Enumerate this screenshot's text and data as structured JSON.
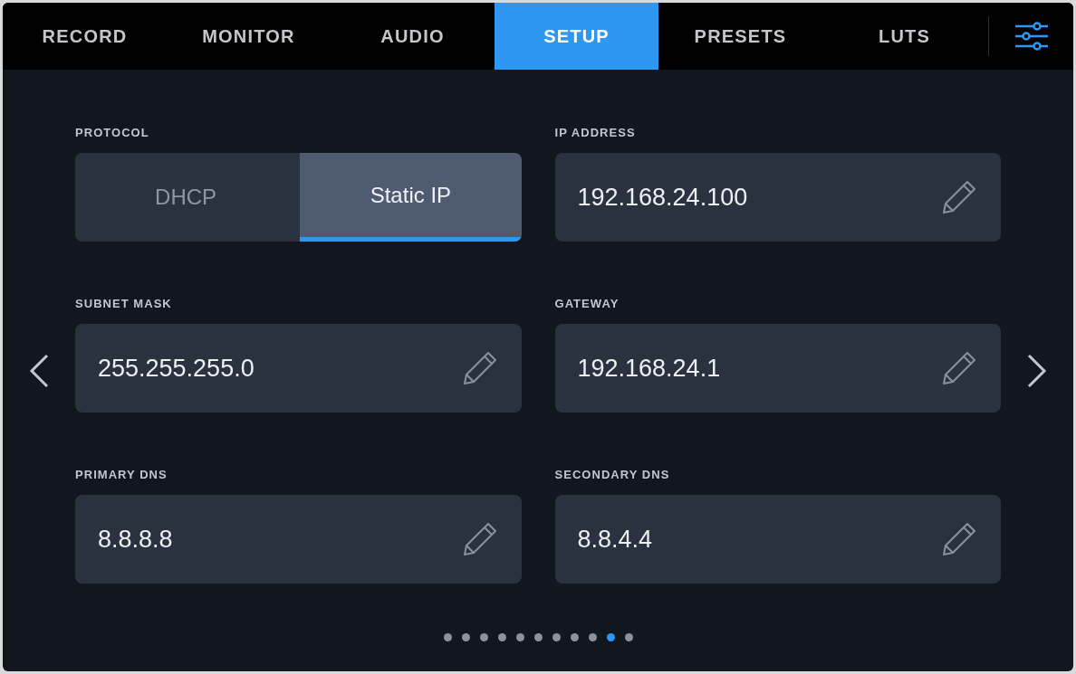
{
  "tabs": [
    {
      "label": "RECORD",
      "selected": false
    },
    {
      "label": "MONITOR",
      "selected": false
    },
    {
      "label": "AUDIO",
      "selected": false
    },
    {
      "label": "SETUP",
      "selected": true
    },
    {
      "label": "PRESETS",
      "selected": false
    },
    {
      "label": "LUTS",
      "selected": false
    }
  ],
  "fields": [
    {
      "kind": "toggle",
      "label": "PROTOCOL",
      "options": [
        {
          "label": "DHCP",
          "selected": false
        },
        {
          "label": "Static IP",
          "selected": true
        }
      ]
    },
    {
      "kind": "text",
      "label": "IP ADDRESS",
      "value": "192.168.24.100"
    },
    {
      "kind": "text",
      "label": "SUBNET MASK",
      "value": "255.255.255.0"
    },
    {
      "kind": "text",
      "label": "GATEWAY",
      "value": "192.168.24.1"
    },
    {
      "kind": "text",
      "label": "PRIMARY DNS",
      "value": "8.8.8.8"
    },
    {
      "kind": "text",
      "label": "SECONDARY DNS",
      "value": "8.8.4.4"
    }
  ],
  "pager": [
    {
      "selected": false
    },
    {
      "selected": false
    },
    {
      "selected": false
    },
    {
      "selected": false
    },
    {
      "selected": false
    },
    {
      "selected": false
    },
    {
      "selected": false
    },
    {
      "selected": false
    },
    {
      "selected": false
    },
    {
      "selected": true
    },
    {
      "selected": false
    }
  ]
}
